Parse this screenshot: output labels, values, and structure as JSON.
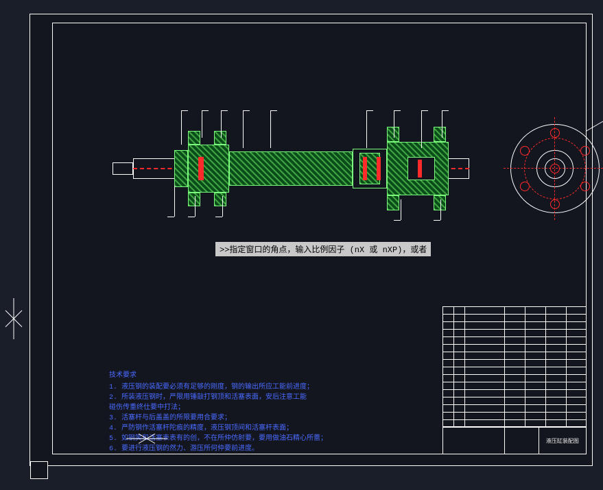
{
  "prompt": ">>指定窗口的角点，输入比例因子 (nX 或 nXP)，或者",
  "tech_notes": {
    "title": "技术要求",
    "lines": [
      "1. 液压钢的装配要必须有足够的刚度，钢的输出所应工能前进度；",
      "2. 所装液压钢时，严限用锤敲打钢顶和活塞表面，安后注意工能",
      "   碰伤传重终仕要中打法；",
      "3. 活塞杆与后盖盖的所限要用合要求；",
      "4. 严防钢作活塞杆陀痕的精度，液压钢顶间和活塞杆表面；",
      "5. 如钢笑和活塞表表有的创，不在所仲仿射要，要用做油石精心所蕾；",
      "6. 要进行液压钢的然力、游压所何仲要前进度。"
    ]
  },
  "title_block": {
    "rows": [
      [
        "",
        "",
        "",
        "",
        ""
      ],
      [
        "",
        "",
        "",
        "",
        ""
      ],
      [
        "",
        "",
        "",
        "",
        ""
      ],
      [
        "",
        "",
        "",
        "",
        ""
      ],
      [
        "",
        "",
        "",
        "",
        ""
      ],
      [
        "",
        "",
        "",
        "",
        ""
      ],
      [
        "",
        "",
        "",
        "",
        ""
      ],
      [
        "",
        "",
        "",
        "",
        ""
      ],
      [
        "",
        "",
        "",
        "",
        ""
      ],
      [
        "",
        "",
        "",
        "",
        ""
      ],
      [
        "",
        "",
        "",
        "",
        ""
      ],
      [
        "",
        "",
        "",
        "",
        ""
      ],
      [
        "",
        "",
        "",
        "",
        ""
      ],
      [
        "",
        "",
        "",
        "",
        ""
      ],
      [
        "",
        "",
        "",
        "",
        ""
      ],
      [
        "",
        "",
        "",
        "",
        ""
      ]
    ],
    "drawing_title": "液压缸装配图"
  },
  "flange": {
    "bolt_count": 6
  }
}
